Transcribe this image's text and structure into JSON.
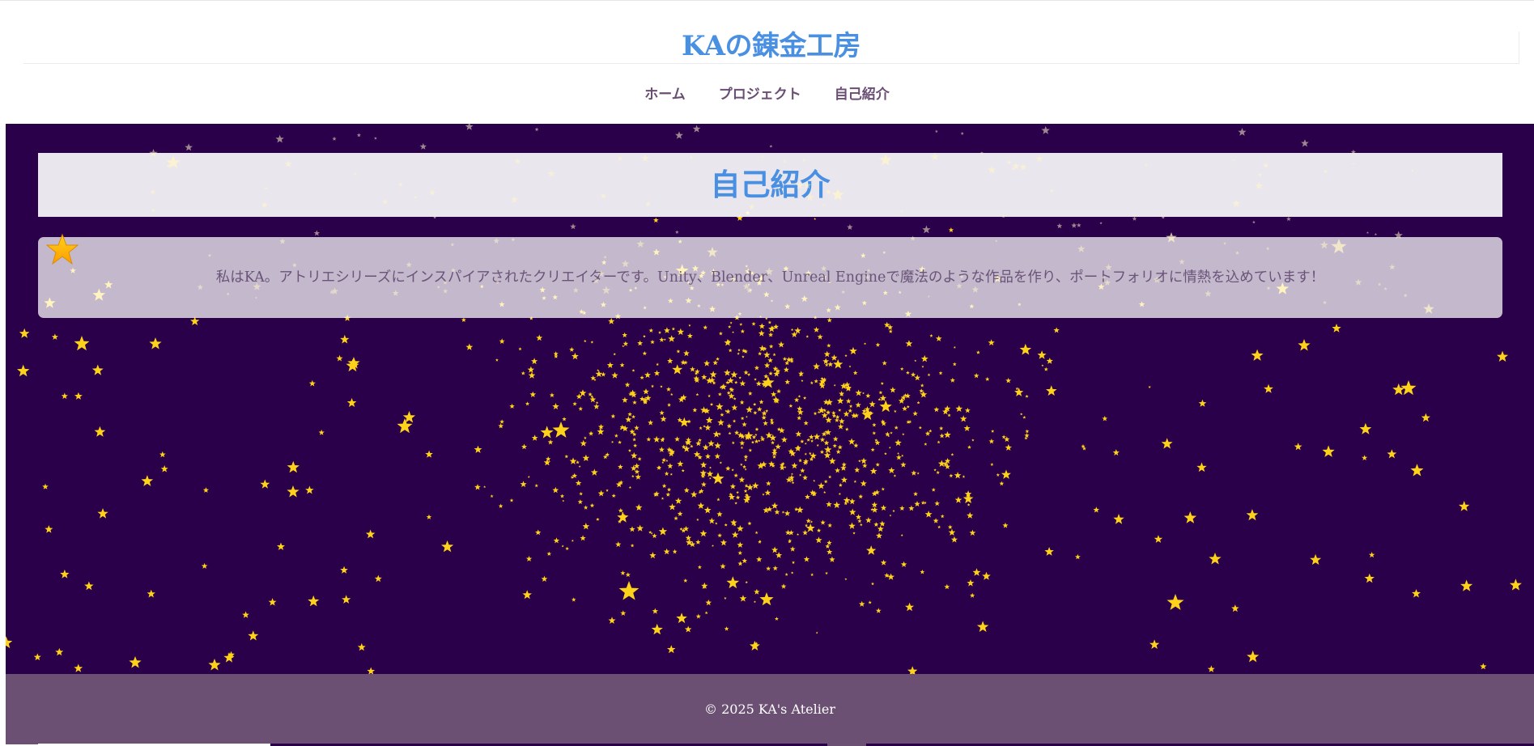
{
  "header": {
    "site_title": "KAの錬金工房",
    "nav": [
      {
        "label": "ホーム"
      },
      {
        "label": "プロジェクト"
      },
      {
        "label": "自己紹介"
      }
    ]
  },
  "main": {
    "heading": "自己紹介",
    "intro": "私はKA。アトリエシリーズにインスパイアされたクリエイターです。Unity、Blender、Unreal Engineで魔法のような作品を作り、ポートフォリオに情熱を込めています！"
  },
  "footer": {
    "copyright": "© 2025 KA's Atelier"
  },
  "colors": {
    "title": "#4a90e2",
    "nav_text": "#6a4e74",
    "background": "#2b004b",
    "footer": "#6b5073",
    "star": "#ffd21a"
  },
  "icons": {
    "corner": "star-icon",
    "decoration": "star-icon"
  }
}
